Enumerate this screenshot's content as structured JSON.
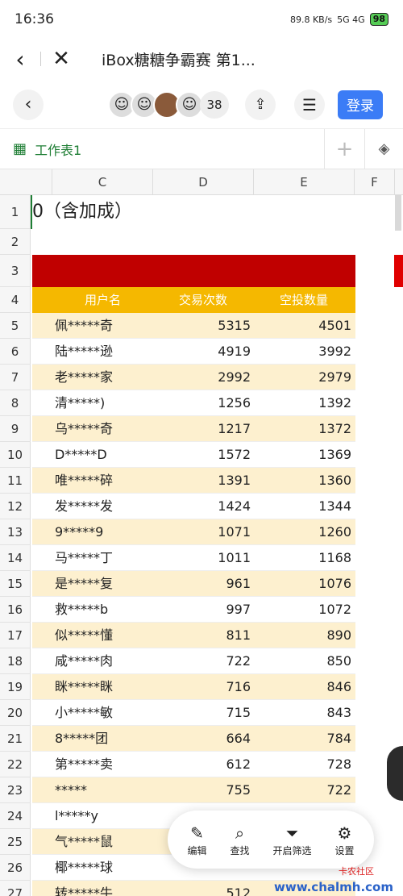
{
  "status": {
    "time": "16:36",
    "speed": "89.8 KB/s",
    "network": "5G 4G",
    "battery": "98"
  },
  "browser": {
    "title": "iBox糖糖争霸赛 第1..."
  },
  "app": {
    "member_count": "38",
    "login": "登录"
  },
  "sheet": {
    "tab": "工作表1"
  },
  "columns": [
    "C",
    "D",
    "E",
    "F"
  ],
  "title_cell": "0（含加成）",
  "table": {
    "headers": [
      "用户名",
      "交易次数",
      "空投数量"
    ],
    "rows": [
      {
        "name": "佩*****奇",
        "d": "5315",
        "e": "4501"
      },
      {
        "name": "陆*****逊",
        "d": "4919",
        "e": "3992"
      },
      {
        "name": "老*****家",
        "d": "2992",
        "e": "2979"
      },
      {
        "name": "清*****)",
        "d": "1256",
        "e": "1392"
      },
      {
        "name": "乌*****奇",
        "d": "1217",
        "e": "1372"
      },
      {
        "name": "D*****D",
        "d": "1572",
        "e": "1369"
      },
      {
        "name": "唯*****碎",
        "d": "1391",
        "e": "1360"
      },
      {
        "name": "发*****发",
        "d": "1424",
        "e": "1344"
      },
      {
        "name": "9*****9",
        "d": "1071",
        "e": "1260"
      },
      {
        "name": "马*****丁",
        "d": "1011",
        "e": "1168"
      },
      {
        "name": "是*****复",
        "d": "961",
        "e": "1076"
      },
      {
        "name": "救*****b",
        "d": "997",
        "e": "1072"
      },
      {
        "name": "似*****懂",
        "d": "811",
        "e": "890"
      },
      {
        "name": "咸*****肉",
        "d": "722",
        "e": "850"
      },
      {
        "name": "眯*****眯",
        "d": "716",
        "e": "846"
      },
      {
        "name": "小*****敏",
        "d": "715",
        "e": "843"
      },
      {
        "name": "8*****团",
        "d": "664",
        "e": "784"
      },
      {
        "name": "第*****卖",
        "d": "612",
        "e": "728"
      },
      {
        "name": "*****",
        "d": "755",
        "e": "722"
      },
      {
        "name": "l*****y",
        "d": "",
        "e": ""
      },
      {
        "name": "气*****鼠",
        "d": "",
        "e": ""
      },
      {
        "name": "椰*****球",
        "d": "",
        "e": ""
      },
      {
        "name": "转*****牛",
        "d": "512",
        "e": ""
      }
    ]
  },
  "toolbar": {
    "edit": "编辑",
    "find": "查找",
    "filter": "开启筛选",
    "settings": "设置"
  },
  "watermark": {
    "text1": "卡农社区",
    "text2": "www.chalmh.com"
  }
}
